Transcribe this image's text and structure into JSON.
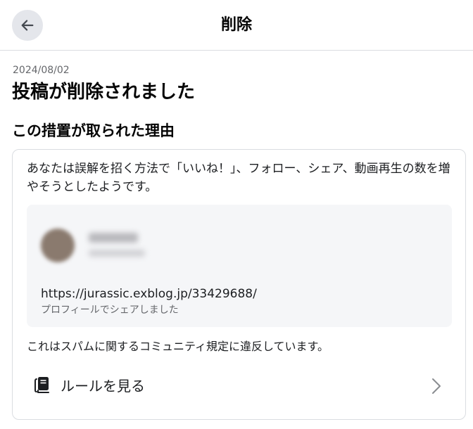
{
  "header": {
    "title": "削除",
    "back_icon": "arrow-left-icon"
  },
  "content": {
    "date": "2024/08/02",
    "title": "投稿が削除されました",
    "reason_heading": "この措置が取られた理由",
    "reason_text": "あなたは誤解を招く方法で「いいね！」、フォロー、シェア、動画再生の数を増やそうとしたようです。",
    "post": {
      "link": "https://jurassic.exblog.jp/33429688/",
      "caption": "プロフィールでシェアしました"
    },
    "violation_text": "これはスパムに関するコミュニティ規定に違反しています。",
    "rules_label": "ルールを見る",
    "rules_icon": "book-icon",
    "chevron_icon": "chevron-right-icon"
  },
  "colors": {
    "text_primary": "#050505",
    "text_secondary": "#65676b",
    "border": "#dadde1",
    "preview_bg": "#f5f6f8",
    "back_button_bg": "#e4e6eb"
  }
}
